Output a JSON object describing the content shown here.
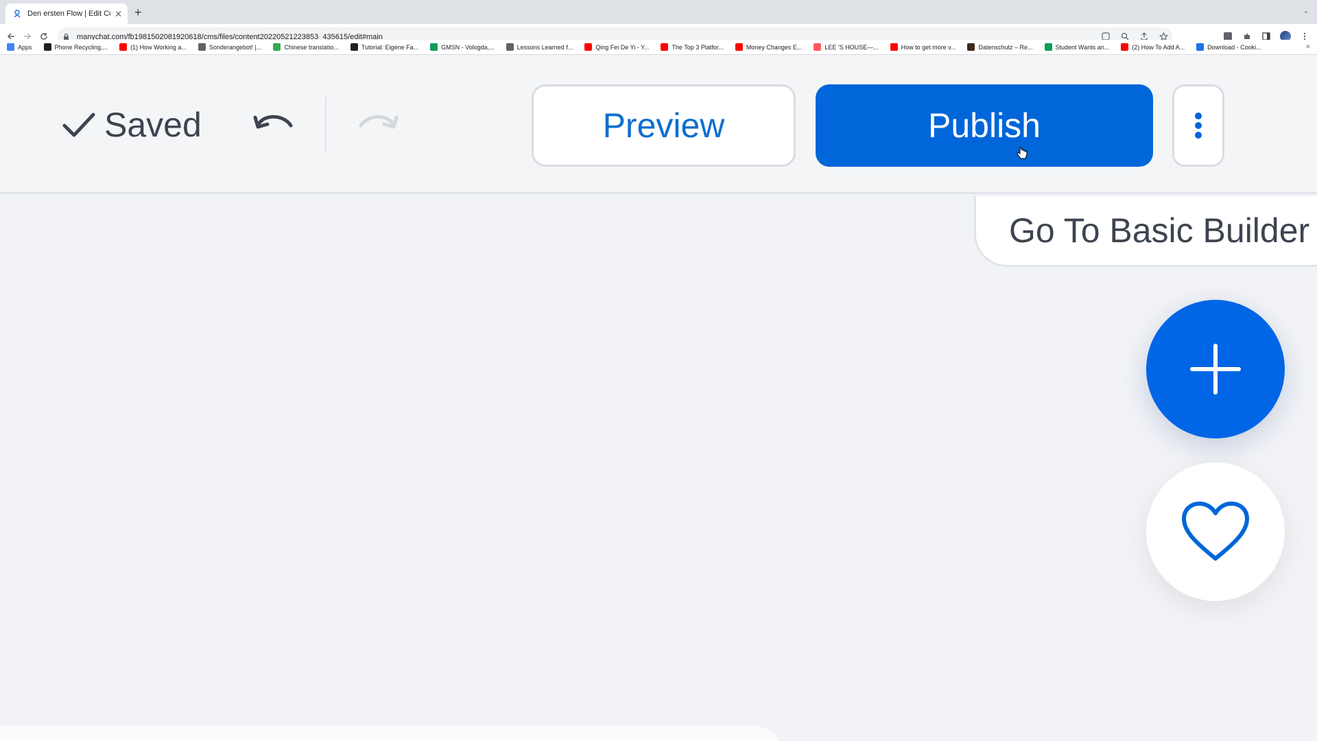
{
  "browser": {
    "tab": {
      "title": "Den ersten Flow | Edit Content"
    },
    "url": "manychat.com/fb198150208192​0618/cms/files/content20220521223853_435615/edit#main",
    "bookmarks": [
      {
        "label": "Apps",
        "color": "#4285f4"
      },
      {
        "label": "Phone Recycling,...",
        "color": "#202124"
      },
      {
        "label": "(1) How Working a...",
        "color": "#ff0000"
      },
      {
        "label": "Sonderangebot! |...",
        "color": "#5f6368"
      },
      {
        "label": "Chinese translatio...",
        "color": "#34a853"
      },
      {
        "label": "Tutorial: Eigene Fa...",
        "color": "#202124"
      },
      {
        "label": "GMSN - Vologda,...",
        "color": "#0f9d58"
      },
      {
        "label": "Lessons Learned f...",
        "color": "#5f6368"
      },
      {
        "label": "Qing Fei De Yi - Y...",
        "color": "#ff0000"
      },
      {
        "label": "The Top 3 Platfor...",
        "color": "#ff0000"
      },
      {
        "label": "Money Changes E...",
        "color": "#ff0000"
      },
      {
        "label": "LEE 'S HOUSE—...",
        "color": "#ff5a5f"
      },
      {
        "label": "How to get more v...",
        "color": "#ff0000"
      },
      {
        "label": "Datenschutz – Re...",
        "color": "#3c2a1e"
      },
      {
        "label": "Student Wants an...",
        "color": "#0f9d58"
      },
      {
        "label": "(2) How To Add A...",
        "color": "#ff0000"
      },
      {
        "label": "Download - Cooki...",
        "color": "#1a73e8"
      }
    ]
  },
  "header": {
    "saved_label": "Saved",
    "preview_label": "Preview",
    "publish_label": "Publish"
  },
  "canvas": {
    "basic_builder_label": "Go To Basic Builder"
  },
  "colors": {
    "accent": "#0066d9",
    "text": "#3d4450"
  }
}
